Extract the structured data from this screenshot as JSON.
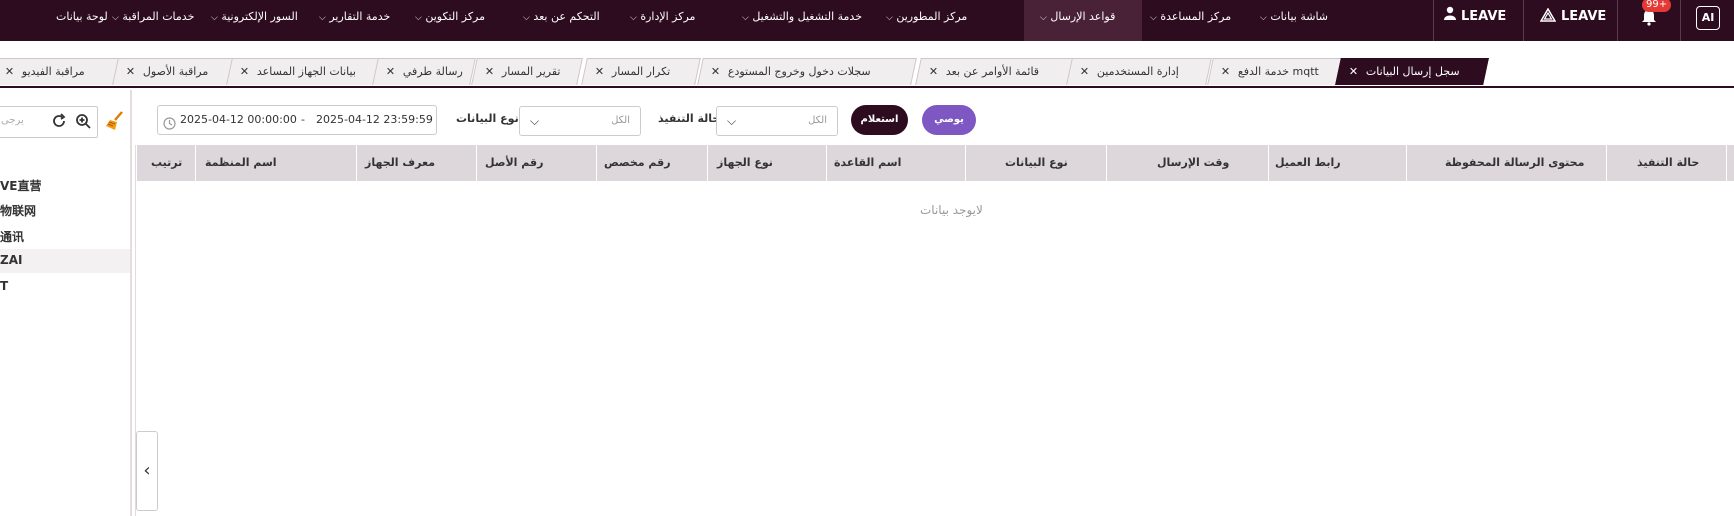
{
  "nav": {
    "items": [
      {
        "label": "لوحة بيانات"
      },
      {
        "label": "خدمات المراقبة"
      },
      {
        "label": "السور الإلكترونية"
      },
      {
        "label": "خدمة التقارير"
      },
      {
        "label": "مركز التكوين"
      },
      {
        "label": "التحكم عن بعد"
      },
      {
        "label": "مركز الإدارة"
      },
      {
        "label": "خدمة التشغيل والتشغيل"
      },
      {
        "label": "مركز المطورين"
      },
      {
        "label": "قواعد الإرسال"
      },
      {
        "label": "مركز المساعدة"
      },
      {
        "label": "شاشة بيانات"
      }
    ],
    "leave_user": "LEAVE",
    "leave_org": "LEAVE",
    "badge": "99+",
    "ai_logo": "AI"
  },
  "tabs": [
    {
      "label": "مراقبة الفيديو"
    },
    {
      "label": "مراقبة الأصول"
    },
    {
      "label": "بيانات الجهاز المساعد"
    },
    {
      "label": "رسالة طرفي"
    },
    {
      "label": "تقرير المسار"
    },
    {
      "label": "تكرار المسار"
    },
    {
      "label": "سجلات دخول وخروج المستودع"
    },
    {
      "label": "قائمة الأوامر عن بعد"
    },
    {
      "label": "إدارة المستخدمين"
    },
    {
      "label": "خدمة الدفع mqtt"
    },
    {
      "label": "سجل إرسال البيانات"
    }
  ],
  "sidebar": {
    "search_placeholder": "يرجى",
    "tree": [
      {
        "label": "VE直营"
      },
      {
        "label": "物联网"
      },
      {
        "label": "通讯"
      },
      {
        "label": "ZAI"
      },
      {
        "label": "T"
      }
    ]
  },
  "filters": {
    "date_start": "2025-04-12 00:00:00",
    "date_sep": "-",
    "date_end": "2025-04-12 23:59:59",
    "data_type_label": "نوع البيانات",
    "data_type_value": "الكل",
    "exec_status_label": "حالة التنفيذ",
    "exec_status_value": "الكل",
    "query_button": "استعلام",
    "recommend_button": "يوصي"
  },
  "table": {
    "headers": [
      "ترتيب",
      "اسم المنظمة",
      "معرف الجهاز",
      "رقم الأصل",
      "رقم مخصص",
      "نوع الجهاز",
      "اسم القاعدة",
      "نوع البيانات",
      "وقت الإرسال",
      "رابط العميل",
      "محتوى الرسالة المحفوظة",
      "حالة التنفيذ"
    ],
    "empty_text": "لايوجد بيانات"
  },
  "colors": {
    "brand": "#2e0c1f",
    "accent": "#7e57c2"
  }
}
